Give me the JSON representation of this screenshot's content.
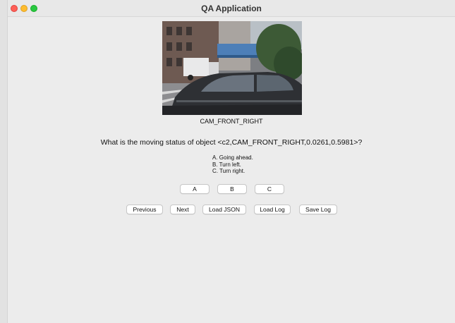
{
  "window": {
    "title": "QA Application"
  },
  "image": {
    "caption": "CAM_FRONT_RIGHT"
  },
  "question": {
    "text": "What is the moving status of object <c2,CAM_FRONT_RIGHT,0.0261,0.5981>?",
    "options": [
      "A. Going ahead.",
      "B. Turn left.",
      "C. Turn right."
    ]
  },
  "answers": {
    "a_label": "A",
    "b_label": "B",
    "c_label": "C"
  },
  "navigation": {
    "previous_label": "Previous",
    "next_label": "Next",
    "load_json_label": "Load JSON",
    "load_log_label": "Load Log",
    "save_log_label": "Save Log"
  },
  "colors": {
    "close": "#fe5f57",
    "minimize": "#febc2e",
    "maximize": "#28c840"
  }
}
